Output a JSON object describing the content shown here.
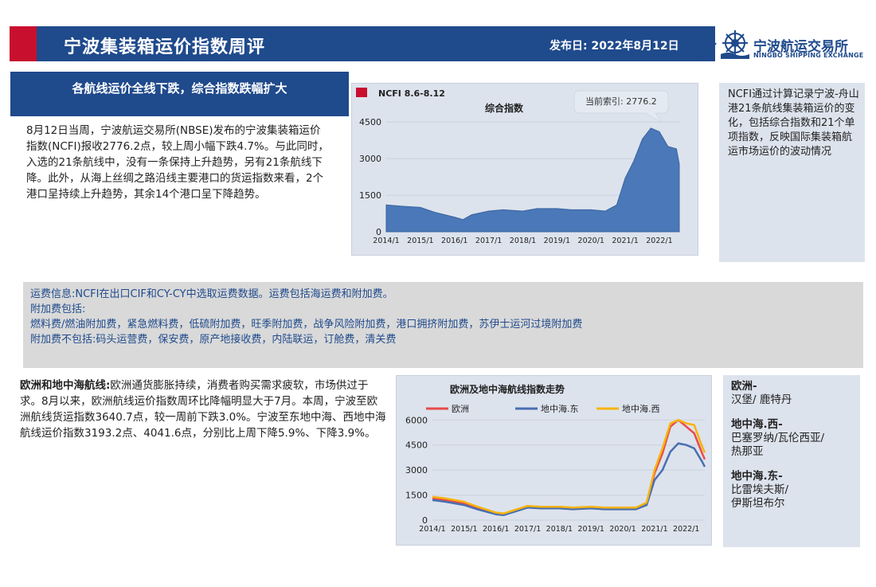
{
  "header": {
    "title": "宁波集装箱运价指数周评",
    "date_label": "发布日: 2022年8月12日",
    "logo_cn": "宁波航运交易所",
    "logo_en": "NINGBO SHIPPING EXCHANGE",
    "accent_red": "#c8102e",
    "brand_blue": "#1f4a8c"
  },
  "section1": {
    "banner": "各航线运价全线下跌，综合指数跌幅扩大",
    "paragraph": "8月12日当周，宁波航运交易所(NBSE)发布的宁波集装箱运价指数(NCFI)报收2776.2点，较上周小幅下跌4.7%。与此同时，入选的21条航线中，没有一条保持上升趋势，另有21条航线下降。此外，从海上丝绸之路沿线主要港口的货运指数来看，2个港口呈持续上升趋势，其余14个港口呈下降趋势。",
    "sidebar": "NCFI通过计算记录宁波-舟山港21条航线集装箱运价的变化，包括综合指数和21个单项指数，反映国际集装箱航运市场运价的波动情况"
  },
  "info": {
    "lines": [
      "运费信息:NCFI在出口CIF和CY-CY中选取运费数据。运费包括海运费和附加费。",
      "附加费包括:",
      "燃料费/燃油附加费，紧急燃料费，低硫附加费，旺季附加费，战争风险附加费，港口拥挤附加费，苏伊士运河过境附加费",
      "附加费不包括:码头运营费，保安费，原产地接收费，内陆联运，订舱费，清关费"
    ]
  },
  "section2": {
    "lead": "欧洲和地中海航线:",
    "paragraph": "欧洲通货膨胀持续，消费者购买需求疲软，市场供过于求。8月以来，欧洲航线运价指数周环比降幅明显大于7月。本周，宁波至欧洲航线货运指数3640.7点，较一周前下跌3.0%。宁波至东地中海、西地中海航线运价指数3193.2点、4041.6点，分别比上周下降5.9%、下降3.9%。",
    "routes": [
      {
        "title": "欧洲-",
        "ports": [
          "汉堡/ 鹿特丹"
        ]
      },
      {
        "title": "地中海.西-",
        "ports": [
          "巴塞罗纳/瓦伦西亚/",
          "热那亚"
        ]
      },
      {
        "title": "地中海.东-",
        "ports": [
          "比雷埃夫斯/",
          "伊斯坦布尔"
        ]
      }
    ]
  },
  "chart_data": [
    {
      "type": "area",
      "legend": "NCFI 8.6-8.12",
      "title": "综合指数",
      "annotation": "当前索引: 2776.2",
      "x_ticks": [
        "2014/1",
        "2015/1",
        "2016/1",
        "2017/1",
        "2018/1",
        "2019/1",
        "2020/1",
        "2021/1",
        "2022/1"
      ],
      "y_ticks": [
        0,
        1500,
        3000,
        4500
      ],
      "ylim": [
        0,
        4800
      ],
      "color": "#4a78b8",
      "x": [
        "2014/1",
        "2014/6",
        "2015/1",
        "2015/6",
        "2016/1",
        "2016/4",
        "2016/7",
        "2017/1",
        "2017/6",
        "2018/1",
        "2018/6",
        "2019/1",
        "2019/6",
        "2020/1",
        "2020/6",
        "2020/10",
        "2021/1",
        "2021/4",
        "2021/7",
        "2021/10",
        "2022/1",
        "2022/4",
        "2022/7",
        "2022/8"
      ],
      "values": [
        1100,
        1050,
        1000,
        800,
        600,
        500,
        700,
        850,
        900,
        850,
        950,
        950,
        900,
        900,
        850,
        1100,
        2200,
        2900,
        3800,
        4250,
        4100,
        3500,
        3400,
        2776
      ]
    },
    {
      "type": "line",
      "title": "欧洲及地中海航线指数走势",
      "x_ticks": [
        "2014/1",
        "2015/1",
        "2016/1",
        "2017/1",
        "2018/1",
        "2019/1",
        "2020/1",
        "2021/1",
        "2022/1"
      ],
      "y_ticks": [
        0,
        1500,
        3000,
        4500,
        6000
      ],
      "ylim": [
        0,
        6300
      ],
      "x": [
        "2014/1",
        "2014/6",
        "2015/1",
        "2015/6",
        "2016/1",
        "2016/4",
        "2016/7",
        "2017/1",
        "2017/6",
        "2018/1",
        "2018/6",
        "2019/1",
        "2019/6",
        "2020/1",
        "2020/6",
        "2020/10",
        "2021/1",
        "2021/4",
        "2021/7",
        "2021/10",
        "2022/1",
        "2022/4",
        "2022/7",
        "2022/8"
      ],
      "series": [
        {
          "name": "欧洲",
          "color": "#e84b4b",
          "values": [
            1300,
            1200,
            1000,
            700,
            400,
            350,
            500,
            800,
            750,
            750,
            700,
            750,
            700,
            700,
            700,
            1000,
            2800,
            4000,
            5600,
            6000,
            5600,
            5200,
            4000,
            3641
          ]
        },
        {
          "name": "地中海.东",
          "color": "#4a6fb0",
          "values": [
            1200,
            1100,
            900,
            650,
            350,
            300,
            450,
            750,
            700,
            700,
            650,
            700,
            650,
            650,
            650,
            900,
            2400,
            3000,
            4100,
            4600,
            4500,
            4300,
            3500,
            3193
          ]
        },
        {
          "name": "地中海.西",
          "color": "#f6b40e",
          "values": [
            1400,
            1300,
            1100,
            800,
            450,
            400,
            550,
            850,
            800,
            800,
            750,
            800,
            750,
            750,
            750,
            1050,
            3000,
            4300,
            5800,
            6000,
            5800,
            5700,
            4400,
            4042
          ]
        }
      ]
    }
  ]
}
